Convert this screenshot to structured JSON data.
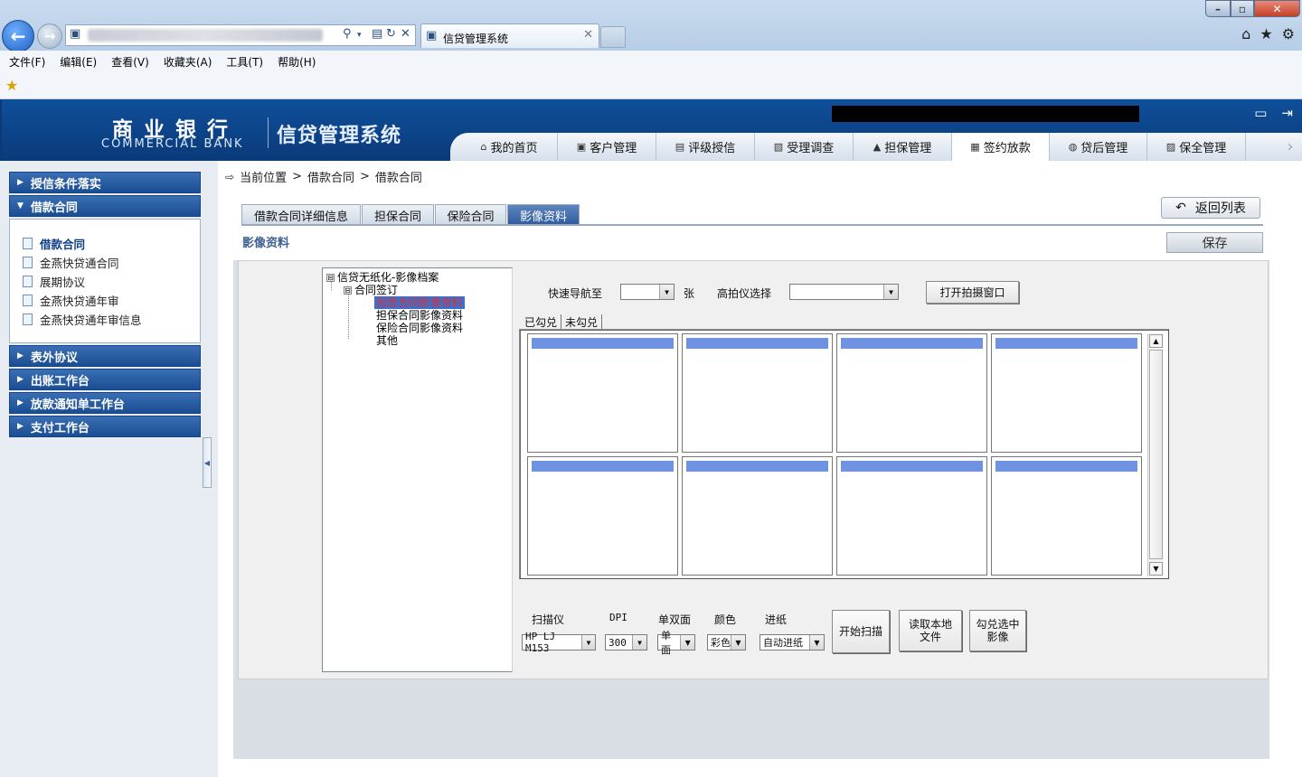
{
  "browser": {
    "tab_title": "信贷管理系统",
    "menu": [
      "文件(F)",
      "编辑(E)",
      "查看(V)",
      "收藏夹(A)",
      "工具(T)",
      "帮助(H)"
    ]
  },
  "header": {
    "logo_cn": "商业银行",
    "logo_en": "COMMERCIAL BANK",
    "system_name": "信贷管理系统",
    "nav_tabs": [
      {
        "label": "我的首页",
        "icon": "home-icon"
      },
      {
        "label": "客户管理",
        "icon": "customer-icon"
      },
      {
        "label": "评级授信",
        "icon": "rating-icon"
      },
      {
        "label": "受理调查",
        "icon": "survey-icon"
      },
      {
        "label": "担保管理",
        "icon": "guarantee-icon"
      },
      {
        "label": "签约放款",
        "icon": "contract-icon",
        "active": true
      },
      {
        "label": "贷后管理",
        "icon": "postloan-icon"
      },
      {
        "label": "保全管理",
        "icon": "preserve-icon"
      }
    ]
  },
  "sidebar": {
    "sections": [
      {
        "label": "授信条件落实"
      },
      {
        "label": "借款合同",
        "expanded": true
      },
      {
        "label": "表外协议"
      },
      {
        "label": "出账工作台"
      },
      {
        "label": "放款通知单工作台"
      },
      {
        "label": "支付工作台"
      }
    ],
    "items": [
      {
        "label": "借款合同",
        "active": true
      },
      {
        "label": "金燕快贷通合同"
      },
      {
        "label": "展期协议"
      },
      {
        "label": "金燕快贷通年审"
      },
      {
        "label": "金燕快贷通年审信息"
      }
    ]
  },
  "breadcrumb": {
    "prefix": "当前位置",
    "sep": ">",
    "level1": "借款合同",
    "level2": "借款合同"
  },
  "subtabs": [
    "借款合同详细信息",
    "担保合同",
    "保险合同",
    "影像资料"
  ],
  "active_subtab": "影像资料",
  "return_label": "返回列表",
  "section_title": "影像资料",
  "save_label": "保存",
  "tree": {
    "root": "信贷无纸化-影像档案",
    "child": "合同签订",
    "leaves": [
      "纸质合同影像资料",
      "担保合同影像资料",
      "保险合同影像资料",
      "其他"
    ],
    "selected": "纸质合同影像资料",
    "root_toggle": "⊟",
    "child_toggle": "⊟"
  },
  "controls": {
    "quick_nav_label": "快速导航至",
    "quick_nav_value": "",
    "unit": "张",
    "camera_label": "高拍仪选择",
    "camera_value": "",
    "open_camera_label": "打开拍摄窗口",
    "view_tabs": [
      "已勾兑",
      "未勾兑"
    ]
  },
  "scan": {
    "scanner_label": "扫描仪",
    "scanner_value": "HP LJ M153",
    "dpi_label": "DPI",
    "dpi_value": "300",
    "side_label": "单双面",
    "side_value": "单面",
    "color_label": "颜色",
    "color_value": "彩色",
    "feed_label": "进纸",
    "feed_value": "自动进纸",
    "start_label": "开始扫描",
    "read_local_label": "读取本地文件",
    "check_selected_label": "勾兑选中影像"
  },
  "colors": {
    "header_blue": "#0f4f9a",
    "sidebar_head": "#2a5da2",
    "thumb_bar": "#6f92e2",
    "tree_selected_bg": "#3a6fd0",
    "tree_selected_text": "#e0302c"
  }
}
